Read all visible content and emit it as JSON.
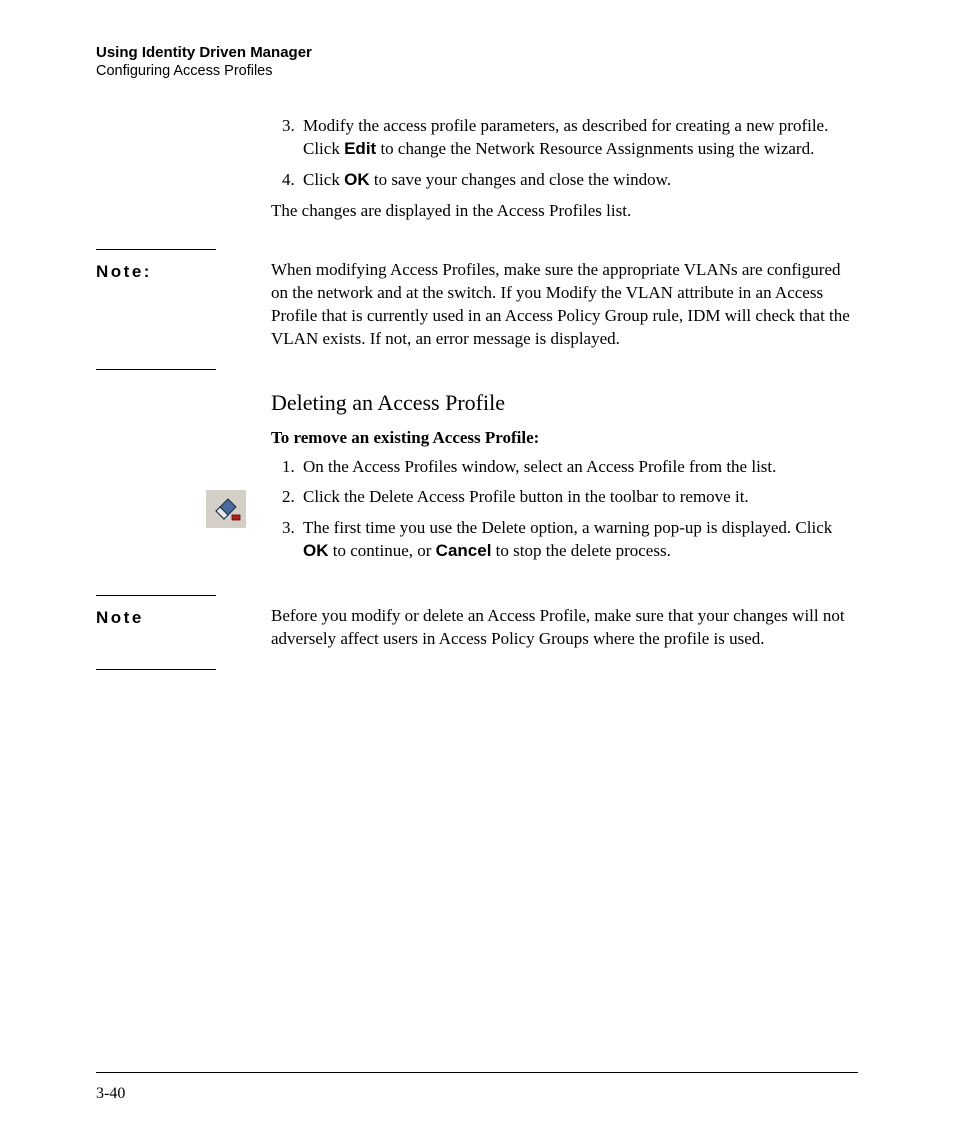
{
  "header": {
    "title": "Using Identity Driven Manager",
    "subtitle": "Configuring Access Profiles"
  },
  "intro_list": {
    "item3_pre": "Modify the access profile parameters, as described for creating a new profile. Click ",
    "item3_bold": "Edit",
    "item3_post": " to change the Network Resource Assignments using the wizard.",
    "item4_pre": "Click ",
    "item4_bold": "OK",
    "item4_post": " to save your changes and close the window."
  },
  "intro_para": "The changes are displayed in the Access Profiles list.",
  "note1": {
    "label": "Note:",
    "body": "When modifying Access Profiles, make sure the appropriate VLANs are configured on the network and at the switch. If you Modify the VLAN attribute in an Access Profile that is currently used in an Access Policy Group rule, IDM will check that the VLAN exists. If not, an error message is displayed."
  },
  "section": {
    "heading": "Deleting an Access Profile",
    "subheading": "To remove an existing Access Profile:",
    "item1": "On the Access Profiles window, select an Access Profile from the list.",
    "item2": "Click the Delete Access Profile button in the toolbar to remove it.",
    "item3_pre": "The first time you use the Delete option, a warning pop-up is displayed. Click ",
    "item3_b1": "OK",
    "item3_mid": " to continue, or ",
    "item3_b2": "Cancel",
    "item3_post": " to stop the delete process."
  },
  "note2": {
    "label": "Note",
    "body": "Before you modify or delete an Access Profile, make sure that your changes will not adversely affect users in Access Policy Groups where the profile is used."
  },
  "page_number": "3-40"
}
